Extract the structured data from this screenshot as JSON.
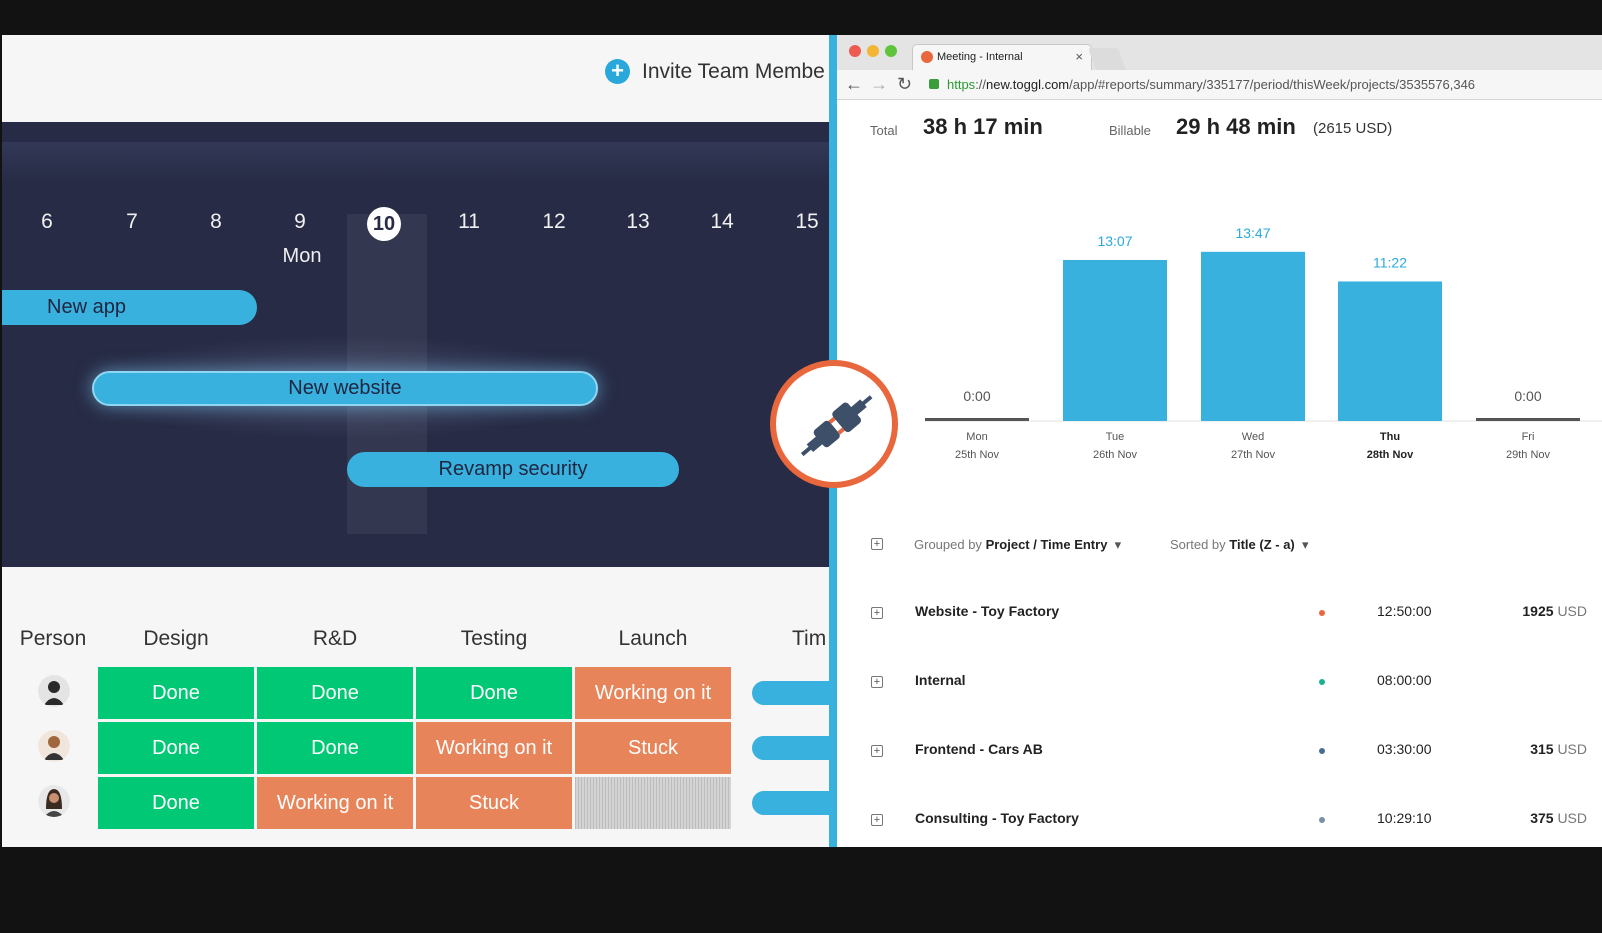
{
  "monday": {
    "invite_label": "Invite Team Membe",
    "timeline": {
      "days": [
        "6",
        "7",
        "8",
        "9",
        "10",
        "11",
        "12",
        "13",
        "14",
        "15"
      ],
      "today": "10",
      "weekday": "Mon",
      "bars": {
        "new_app": "New app",
        "new_website": "New website",
        "revamp_security": "Revamp security"
      }
    },
    "board": {
      "columns": [
        "Person",
        "Design",
        "R&D",
        "Testing",
        "Launch",
        "Tim"
      ],
      "rows": [
        {
          "design": "Done",
          "rd": "Done",
          "testing": "Done",
          "launch": "Working on it"
        },
        {
          "design": "Done",
          "rd": "Done",
          "testing": "Working on it",
          "launch": "Stuck"
        },
        {
          "design": "Done",
          "rd": "Working on it",
          "testing": "Stuck",
          "launch": ""
        }
      ]
    }
  },
  "browser": {
    "tab_title": "Meeting - Internal",
    "tab_close": "×",
    "url_scheme": "https",
    "url_sep": "://",
    "url_host": "new.toggl.com",
    "url_path": "/app/#reports/summary/335177/period/thisWeek/projects/3535576,346",
    "nav": {
      "back": "←",
      "forward": "→",
      "reload": "↻"
    }
  },
  "toggl": {
    "total_label": "Total",
    "total_value": "38 h 17 min",
    "billable_label": "Billable",
    "billable_value": "29 h 48 min",
    "billable_amount": "(2615 USD)",
    "grouped_prefix": "Grouped by",
    "grouped_value": "Project / Time Entry",
    "sorted_prefix": "Sorted by",
    "sorted_value": "Title (Z - a)",
    "projects": [
      {
        "name": "Website - Toy Factory",
        "duration": "12:50:00",
        "amount": "1925",
        "currency": "USD",
        "color": "#e8673d"
      },
      {
        "name": "Internal",
        "duration": "08:00:00",
        "amount": "",
        "currency": "",
        "color": "#1ab291"
      },
      {
        "name": "Frontend - Cars AB",
        "duration": "03:30:00",
        "amount": "315",
        "currency": "USD",
        "color": "#4a6c8f"
      },
      {
        "name": "Consulting - Toy Factory",
        "duration": "10:29:10",
        "amount": "375",
        "currency": "USD",
        "color": "#7a8fa6"
      }
    ]
  },
  "chart_data": {
    "type": "bar",
    "categories": [
      "Mon 25th Nov",
      "Tue 26th Nov",
      "Wed 27th Nov",
      "Thu 28th Nov",
      "Fri 29th Nov"
    ],
    "day_names": [
      "Mon",
      "Tue",
      "Wed",
      "Thu",
      "Fri"
    ],
    "dates": [
      "25th Nov",
      "26th Nov",
      "27th Nov",
      "28th Nov",
      "29th Nov"
    ],
    "values": [
      0,
      13.117,
      13.783,
      11.367,
      0
    ],
    "value_labels": [
      "0:00",
      "13:07",
      "13:47",
      "11:22",
      "0:00"
    ],
    "highlighted": "Thu",
    "ylim": [
      0,
      14.5
    ],
    "grid": false
  },
  "colors": {
    "accent": "#39b1de",
    "done": "#00c875",
    "working": "#e8845a",
    "timeline_bg": "#272b45",
    "plug_ring": "#e8673d"
  },
  "icons": [
    "plus-circle-icon",
    "plug-icon",
    "expand-icon",
    "dropdown-caret-icon"
  ]
}
